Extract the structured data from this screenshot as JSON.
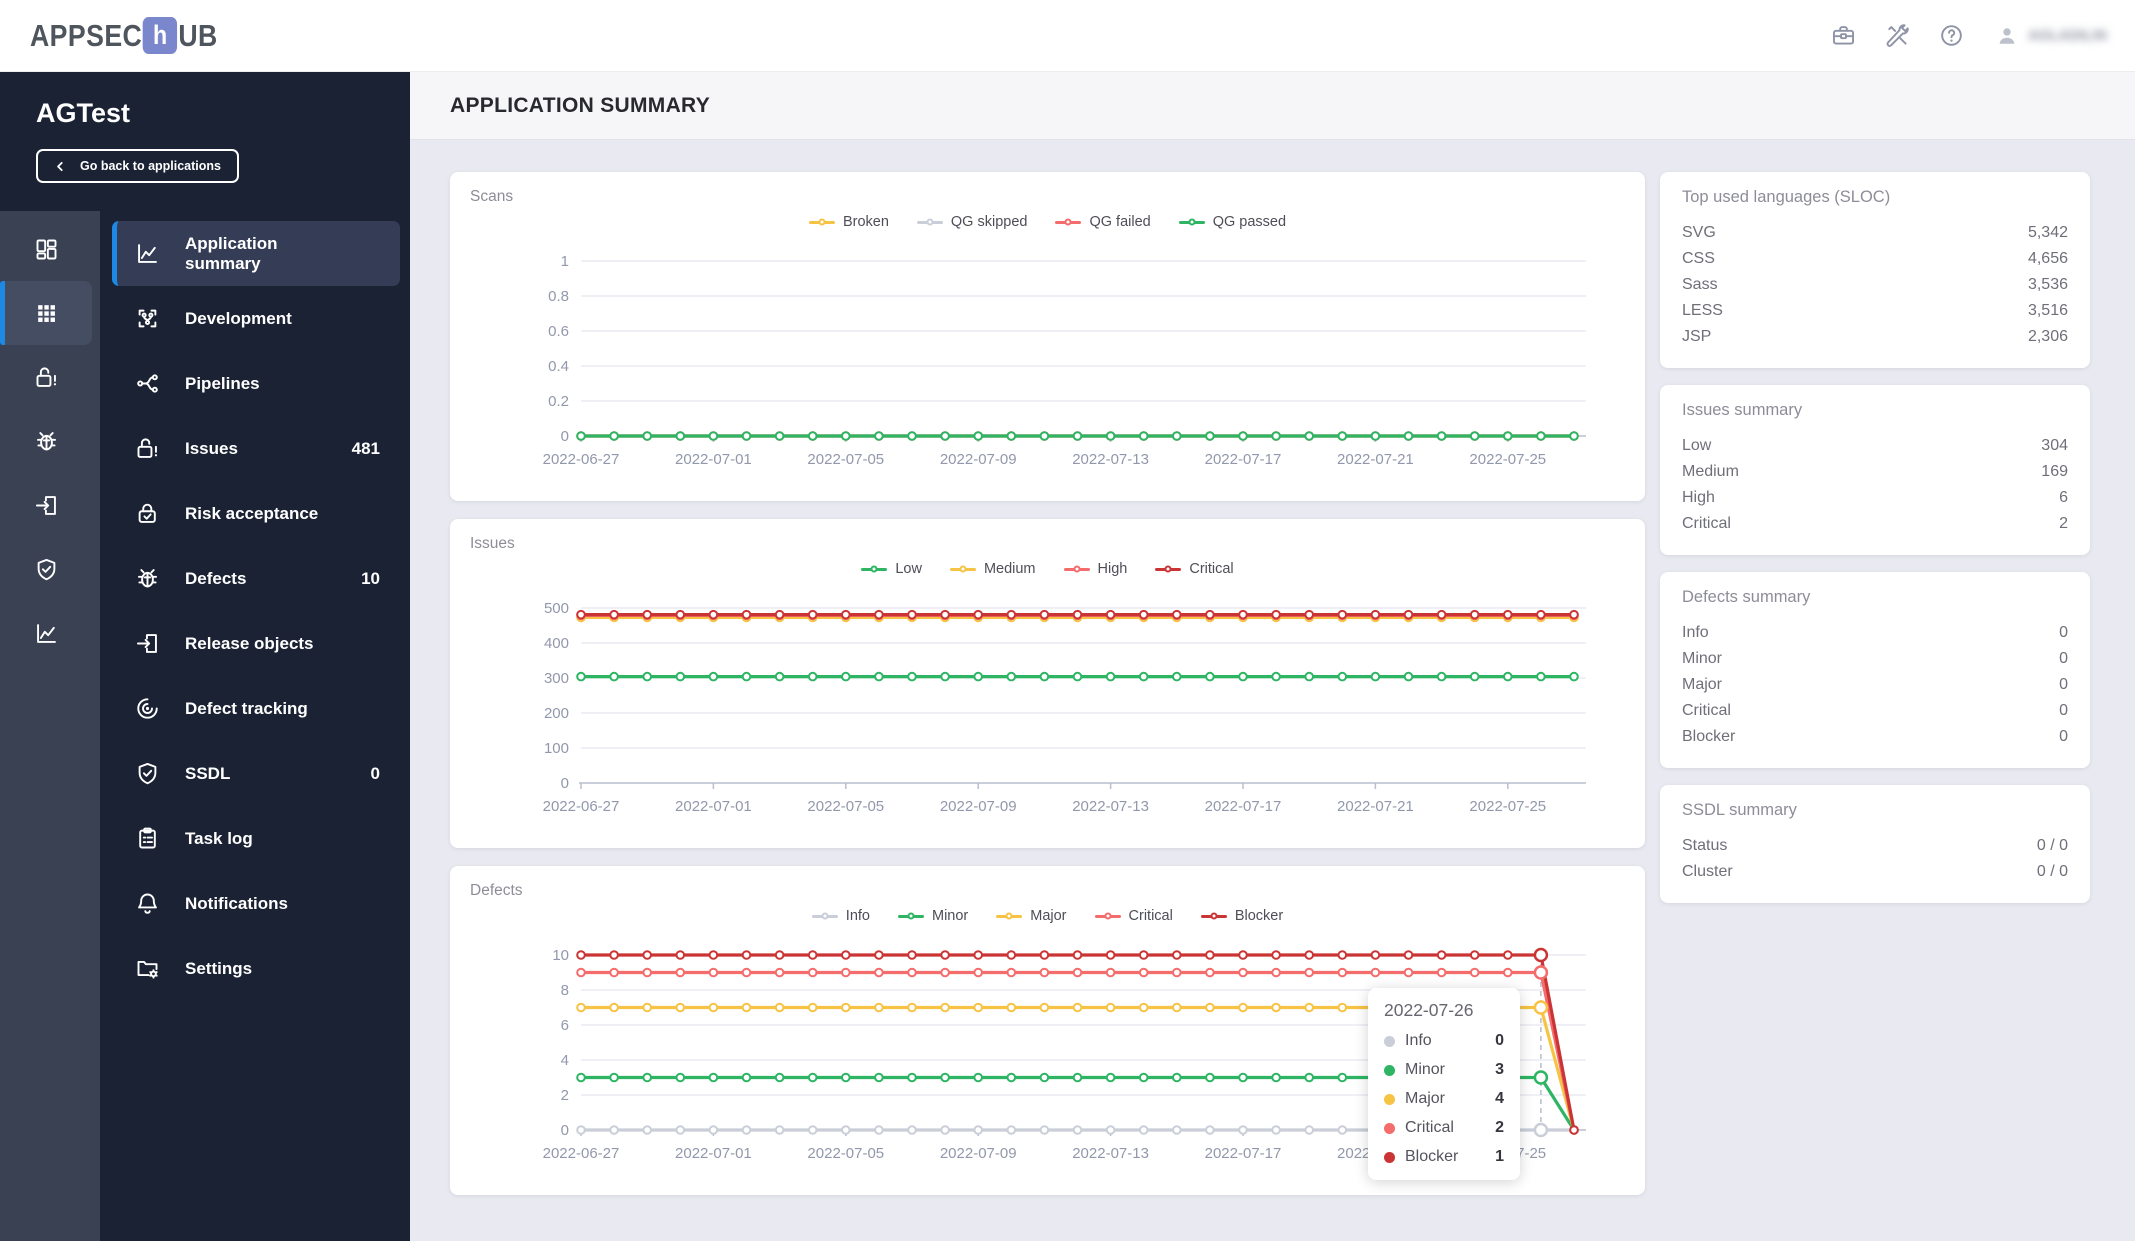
{
  "topbar": {
    "logo": {
      "part1": "APPSEC",
      "tile": "h",
      "part2": "UB"
    },
    "user_name": "AGLADILIN"
  },
  "sidebar": {
    "project_title": "AGTest",
    "back_button_label": "Go back to applications",
    "menu": [
      {
        "label": "Application summary",
        "badge": ""
      },
      {
        "label": "Development",
        "badge": ""
      },
      {
        "label": "Pipelines",
        "badge": ""
      },
      {
        "label": "Issues",
        "badge": "481"
      },
      {
        "label": "Risk acceptance",
        "badge": ""
      },
      {
        "label": "Defects",
        "badge": "10"
      },
      {
        "label": "Release objects",
        "badge": ""
      },
      {
        "label": "Defect tracking",
        "badge": ""
      },
      {
        "label": "SSDL",
        "badge": "0"
      },
      {
        "label": "Task log",
        "badge": ""
      },
      {
        "label": "Notifications",
        "badge": ""
      },
      {
        "label": "Settings",
        "badge": ""
      }
    ]
  },
  "page": {
    "title": "APPLICATION SUMMARY"
  },
  "chart_data": [
    {
      "type": "line",
      "title": "Scans",
      "legend": [
        {
          "label": "Broken",
          "color": "#F6C344"
        },
        {
          "label": "QG skipped",
          "color": "#C9CED8"
        },
        {
          "label": "QG failed",
          "color": "#F56C6C"
        },
        {
          "label": "QG passed",
          "color": "#2DB563"
        }
      ],
      "plot": {
        "stacked": false,
        "y_max": 1,
        "y_ticks": [
          0,
          0.2,
          0.4,
          0.6,
          0.8,
          1
        ],
        "n_points": 31,
        "label_every": 4,
        "x_labels": [
          "2022-06-27",
          "2022-07-01",
          "2022-07-05",
          "2022-07-09",
          "2022-07-13",
          "2022-07-17",
          "2022-07-21",
          "2022-07-25"
        ],
        "series": [
          {
            "name": "Broken",
            "color": "#F6C344",
            "const": 0,
            "count": 31
          },
          {
            "name": "QG skipped",
            "color": "#C9CED8",
            "const": 0,
            "count": 31
          },
          {
            "name": "QG failed",
            "color": "#F56C6C",
            "const": 0,
            "count": 31
          },
          {
            "name": "QG passed",
            "color": "#2DB563",
            "const": 0,
            "count": 31
          }
        ]
      }
    },
    {
      "type": "line",
      "title": "Issues",
      "legend": [
        {
          "label": "Low",
          "color": "#2DB563"
        },
        {
          "label": "Medium",
          "color": "#F6C344"
        },
        {
          "label": "High",
          "color": "#F56C6C"
        },
        {
          "label": "Critical",
          "color": "#CB3434"
        }
      ],
      "plot": {
        "stacked": true,
        "y_max": 500,
        "y_ticks": [
          0,
          100,
          200,
          300,
          400,
          500
        ],
        "n_points": 31,
        "label_every": 4,
        "x_labels": [
          "2022-06-27",
          "2022-07-01",
          "2022-07-05",
          "2022-07-09",
          "2022-07-13",
          "2022-07-17",
          "2022-07-21",
          "2022-07-25"
        ],
        "series": [
          {
            "name": "Low",
            "color": "#2DB563",
            "const": 304,
            "count": 31
          },
          {
            "name": "Medium",
            "color": "#F6C344",
            "const": 169,
            "count": 31
          },
          {
            "name": "High",
            "color": "#F56C6C",
            "const": 6,
            "count": 31
          },
          {
            "name": "Critical",
            "color": "#CB3434",
            "const": 2,
            "count": 31
          }
        ]
      }
    },
    {
      "type": "line",
      "title": "Defects",
      "legend": [
        {
          "label": "Info",
          "color": "#C9CED8"
        },
        {
          "label": "Minor",
          "color": "#2DB563"
        },
        {
          "label": "Major",
          "color": "#F6C344"
        },
        {
          "label": "Critical",
          "color": "#F56C6C"
        },
        {
          "label": "Blocker",
          "color": "#CB3434"
        }
      ],
      "plot": {
        "stacked": true,
        "y_max": 10,
        "y_ticks": [
          0,
          2,
          4,
          6,
          8,
          10
        ],
        "n_points": 31,
        "label_every": 4,
        "hover_index": 29,
        "x_labels": [
          "2022-06-27",
          "2022-07-01",
          "2022-07-05",
          "2022-07-09",
          "2022-07-13",
          "2022-07-17",
          "2022-07-21",
          "2022-07-25"
        ],
        "series": [
          {
            "name": "Info",
            "color": "#C9CED8",
            "const": 0,
            "count": 31
          },
          {
            "name": "Minor",
            "color": "#2DB563",
            "const": 3,
            "count": 31,
            "overrides": {
              "30": 0
            }
          },
          {
            "name": "Major",
            "color": "#F6C344",
            "const": 4,
            "count": 31,
            "overrides": {
              "30": 0
            }
          },
          {
            "name": "Critical",
            "color": "#F56C6C",
            "const": 2,
            "count": 31,
            "overrides": {
              "30": 0
            }
          },
          {
            "name": "Blocker",
            "color": "#CB3434",
            "const": 1,
            "count": 31,
            "overrides": {
              "30": 0
            }
          }
        ]
      },
      "tooltip": {
        "date": "2022-07-26",
        "rows": [
          {
            "label": "Info",
            "value": "0",
            "color": "#C9CED8"
          },
          {
            "label": "Minor",
            "value": "3",
            "color": "#2DB563"
          },
          {
            "label": "Major",
            "value": "4",
            "color": "#F6C344"
          },
          {
            "label": "Critical",
            "value": "2",
            "color": "#F56C6C"
          },
          {
            "label": "Blocker",
            "value": "1",
            "color": "#CB3434"
          }
        ]
      }
    }
  ],
  "side_panels": {
    "languages": {
      "title": "Top used languages (SLOC)",
      "rows": [
        {
          "label": "SVG",
          "value": "5,342"
        },
        {
          "label": "CSS",
          "value": "4,656"
        },
        {
          "label": "Sass",
          "value": "3,536"
        },
        {
          "label": "LESS",
          "value": "3,516"
        },
        {
          "label": "JSP",
          "value": "2,306"
        }
      ]
    },
    "issues_summary": {
      "title": "Issues summary",
      "rows": [
        {
          "label": "Low",
          "value": "304"
        },
        {
          "label": "Medium",
          "value": "169"
        },
        {
          "label": "High",
          "value": "6"
        },
        {
          "label": "Critical",
          "value": "2"
        }
      ]
    },
    "defects_summary": {
      "title": "Defects summary",
      "rows": [
        {
          "label": "Info",
          "value": "0"
        },
        {
          "label": "Minor",
          "value": "0"
        },
        {
          "label": "Major",
          "value": "0"
        },
        {
          "label": "Critical",
          "value": "0"
        },
        {
          "label": "Blocker",
          "value": "0"
        }
      ]
    },
    "ssdl_summary": {
      "title": "SSDL summary",
      "rows": [
        {
          "label": "Status",
          "value": "0 / 0"
        },
        {
          "label": "Cluster",
          "value": "0 / 0"
        }
      ]
    }
  },
  "colors": {
    "accent_blue": "#1E88E5",
    "logo_purple": "#7B87CD",
    "green": "#2DB563",
    "yellow": "#F6C344",
    "gray": "#C9CED8",
    "salmon": "#F56C6C",
    "dark_red": "#CB3434"
  }
}
